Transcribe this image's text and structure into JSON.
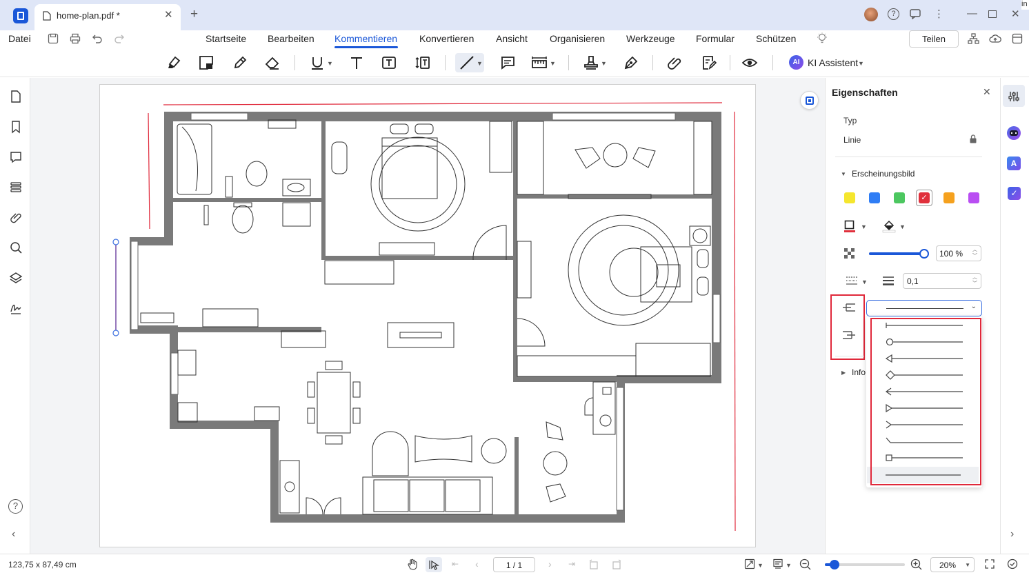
{
  "app": {
    "tab_title": "home-plan.pdf *",
    "corner_letter": "in"
  },
  "menu": {
    "file": "Datei",
    "items": [
      "Startseite",
      "Bearbeiten",
      "Kommentieren",
      "Konvertieren",
      "Ansicht",
      "Organisieren",
      "Werkzeuge",
      "Formular",
      "Schützen"
    ],
    "active_index": 2,
    "share": "Teilen"
  },
  "toolbar": {
    "ai_badge": "AI",
    "ai_assistant": "KI Assistent"
  },
  "left_sidebar": {
    "icons": [
      "page-icon",
      "bookmark-icon",
      "comment-icon",
      "list-icon",
      "attachment-icon",
      "search-icon",
      "layers-icon",
      "signature-icon"
    ]
  },
  "panel": {
    "title": "Eigenschaften",
    "type_label": "Typ",
    "type_value": "Linie",
    "appearance": "Erscheinungsbild",
    "colors": [
      "#f5e62e",
      "#2f7df5",
      "#4cc760",
      "#e0303c",
      "#f5a11e",
      "#b94ef2"
    ],
    "selected_color": "#e0303c",
    "opacity": "100 %",
    "opacity_fraction": 1.0,
    "line_width": "0,1",
    "info": "Info",
    "line_end_styles": [
      "bar",
      "circle",
      "open-triangle",
      "diamond",
      "arrow",
      "triangle",
      "chevron",
      "slash",
      "square",
      "none"
    ]
  },
  "status": {
    "dimensions": "123,75 x 87,49 cm",
    "page": "1 / 1",
    "zoom": "20%",
    "zoom_fraction": 0.12
  },
  "colors": {
    "accent": "#1a57d8",
    "highlight_red": "#e0283a",
    "wall": "#7a7a7a"
  }
}
